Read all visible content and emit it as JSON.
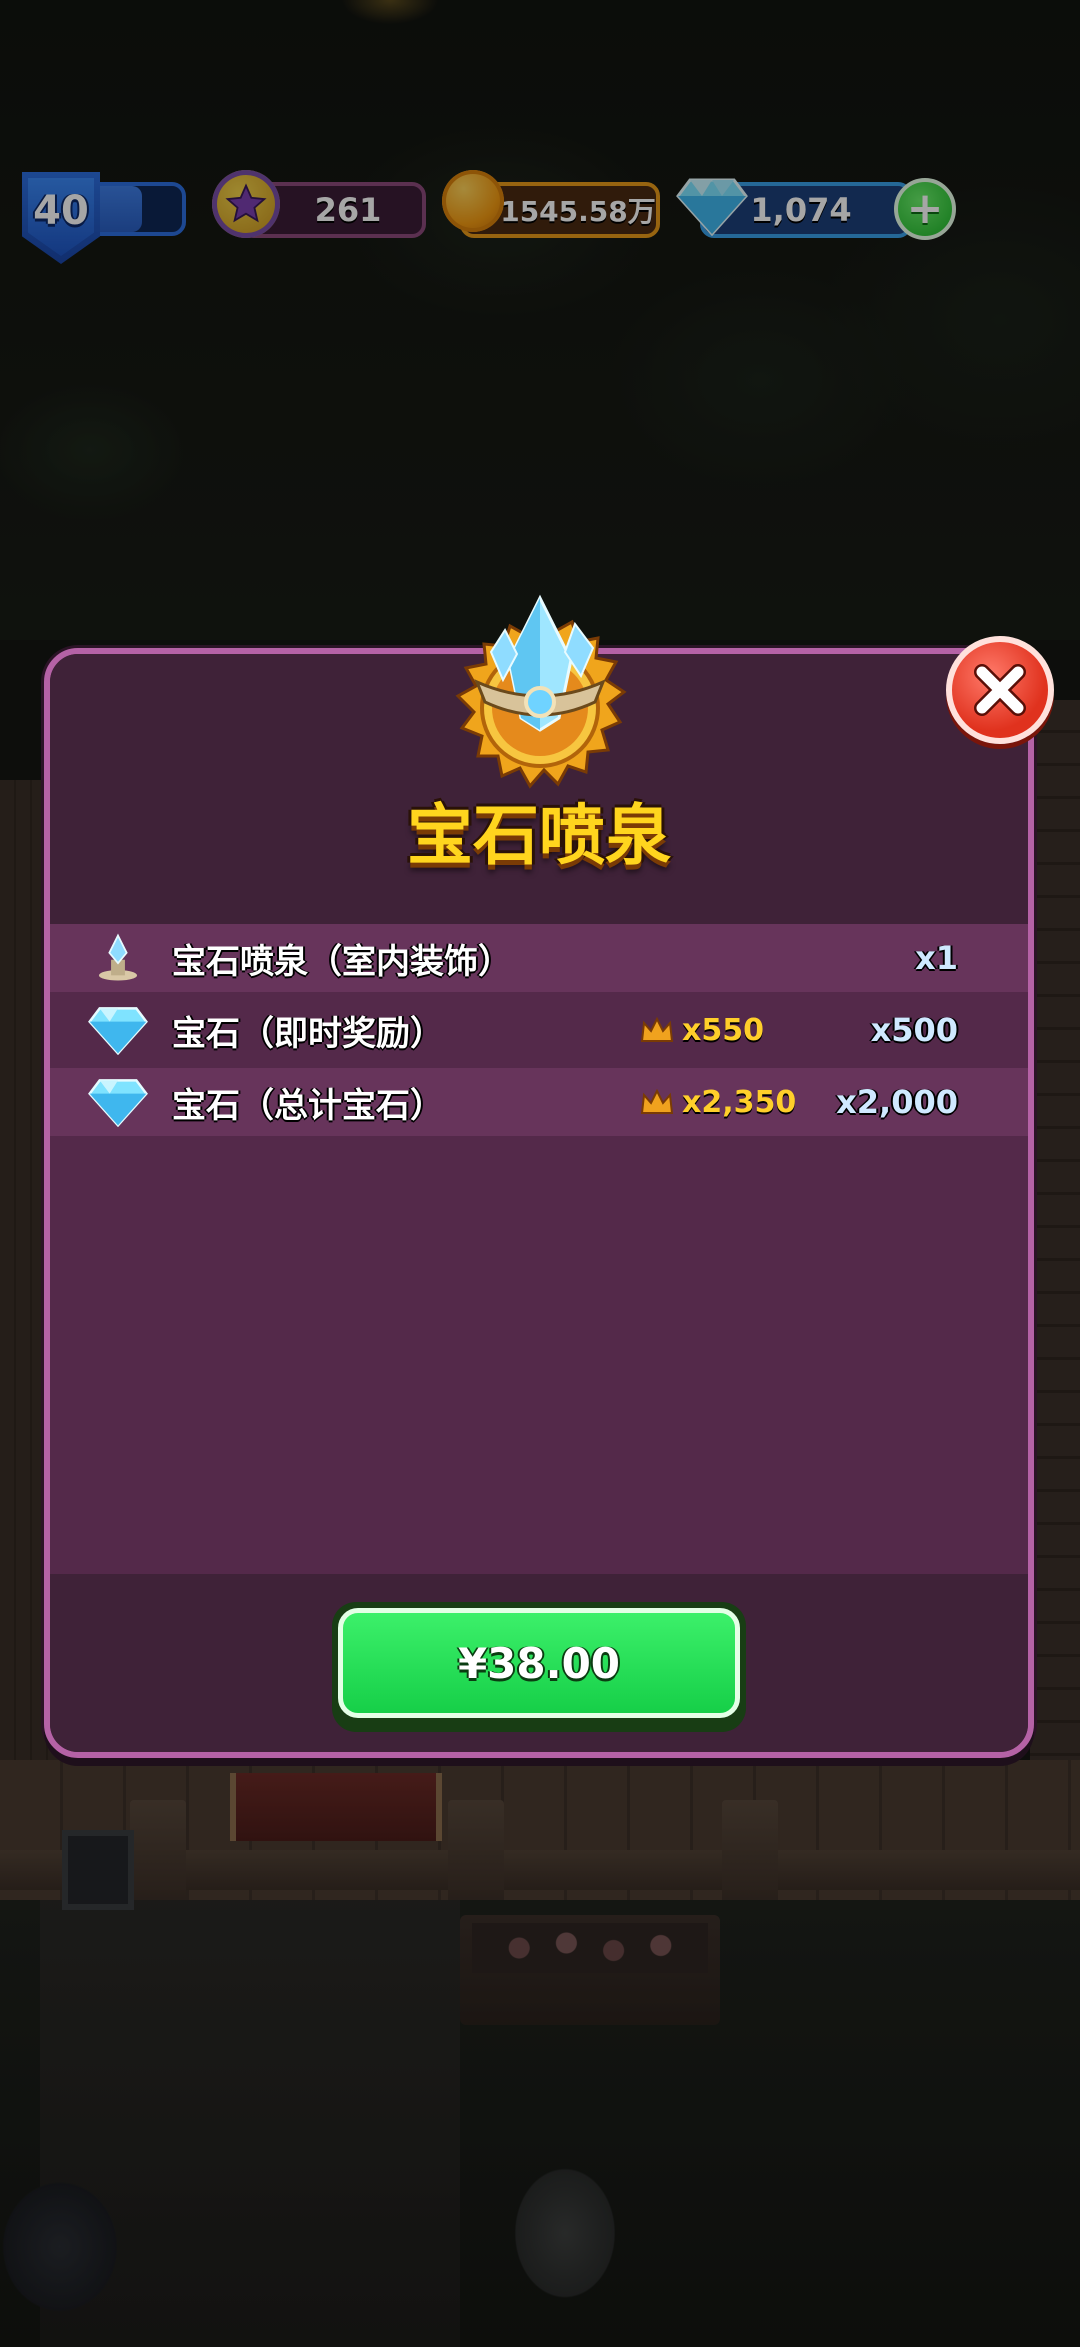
{
  "hud": {
    "level": "40",
    "xp_progress": 0.55,
    "stars": "261",
    "coins": "1545.58万",
    "gems": "1,074",
    "add_gems_label": "+"
  },
  "dialog": {
    "title": "宝石喷泉",
    "badge_icon": "crystal-fountain-icon",
    "items": [
      {
        "icon": "fountain-icon",
        "name": "宝石喷泉（室内装饰）",
        "bonus": "",
        "quantity": "x1"
      },
      {
        "icon": "diamond-icon",
        "name": "宝石（即时奖励）",
        "bonus": "x550",
        "quantity": "x500"
      },
      {
        "icon": "diamond-icon",
        "name": "宝石（总计宝石）",
        "bonus": "x2,350",
        "quantity": "x2,000"
      }
    ],
    "price_label": "¥38.00"
  },
  "colors": {
    "panel": "#3f2238",
    "panel_border": "#b562a6",
    "row_alt": "#67345b",
    "title": "#ffd51e",
    "buy_button": "#22de56",
    "close_button": "#e8402c"
  }
}
